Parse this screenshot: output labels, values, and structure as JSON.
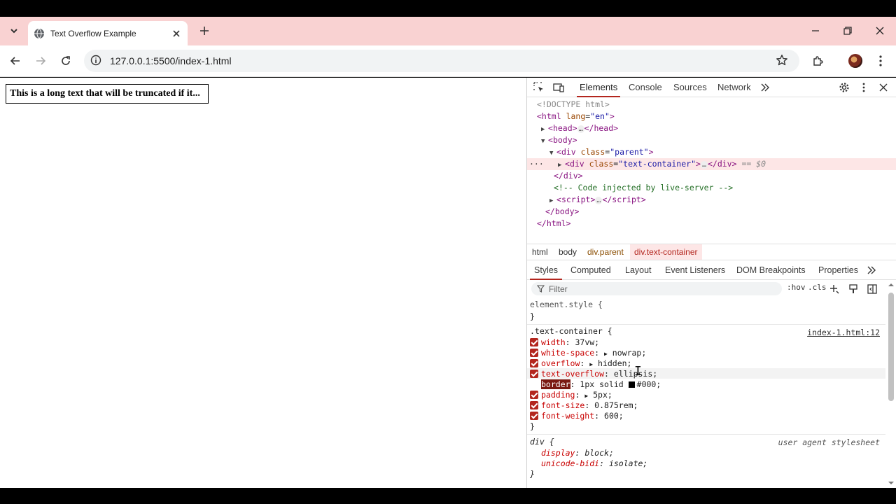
{
  "browser": {
    "tab_title": "Text Overflow Example",
    "url": "127.0.0.1:5500/index-1.html"
  },
  "page": {
    "text": "This is a long text that will be truncated if it..."
  },
  "devtools": {
    "tabs": [
      "Elements",
      "Console",
      "Sources",
      "Network"
    ],
    "dom": [
      "<!DOCTYPE html>",
      "<html",
      "lang",
      "\"en\"",
      "head",
      "body",
      "div",
      "class",
      "\"parent\"",
      "\"text-container\"",
      "== $0",
      "</div>",
      "<!-- Code injected by live-server -->",
      "script",
      "</body>",
      "</html>"
    ],
    "breadcrumbs": [
      "html",
      "body",
      "div.parent",
      "div.text-container"
    ],
    "sub_tabs": [
      "Styles",
      "Computed",
      "Layout",
      "Event Listeners",
      "DOM Breakpoints",
      "Properties"
    ],
    "filter_placeholder": "Filter",
    "hov": ":hov",
    "cls": ".cls",
    "styles": {
      "element_style": "element.style {",
      "close": "}",
      "rule_selector": ".text-container {",
      "rule_source": "index-1.html:12",
      "decls": [
        {
          "p": "width",
          "v": "37vw;"
        },
        {
          "p": "white-space",
          "v": "nowrap;"
        },
        {
          "p": "overflow",
          "v": "hidden;"
        },
        {
          "p": "text-overflow",
          "v": "ellipsis;"
        },
        {
          "p": "border",
          "v": "1px solid"
        },
        {
          "p": "padding",
          "v": "5px;"
        },
        {
          "p": "font-size",
          "v": "0.875rem;"
        },
        {
          "p": "font-weight",
          "v": "600;"
        }
      ],
      "border_color": "#000;",
      "ua_selector": "div {",
      "ua_label": "user agent stylesheet",
      "ua_decls": [
        {
          "p": "display",
          "v": "block;"
        },
        {
          "p": "unicode-bidi",
          "v": "isolate;"
        }
      ]
    }
  },
  "colors": {
    "tabbar": "#f9d2d2",
    "accent": "#b3261e"
  }
}
